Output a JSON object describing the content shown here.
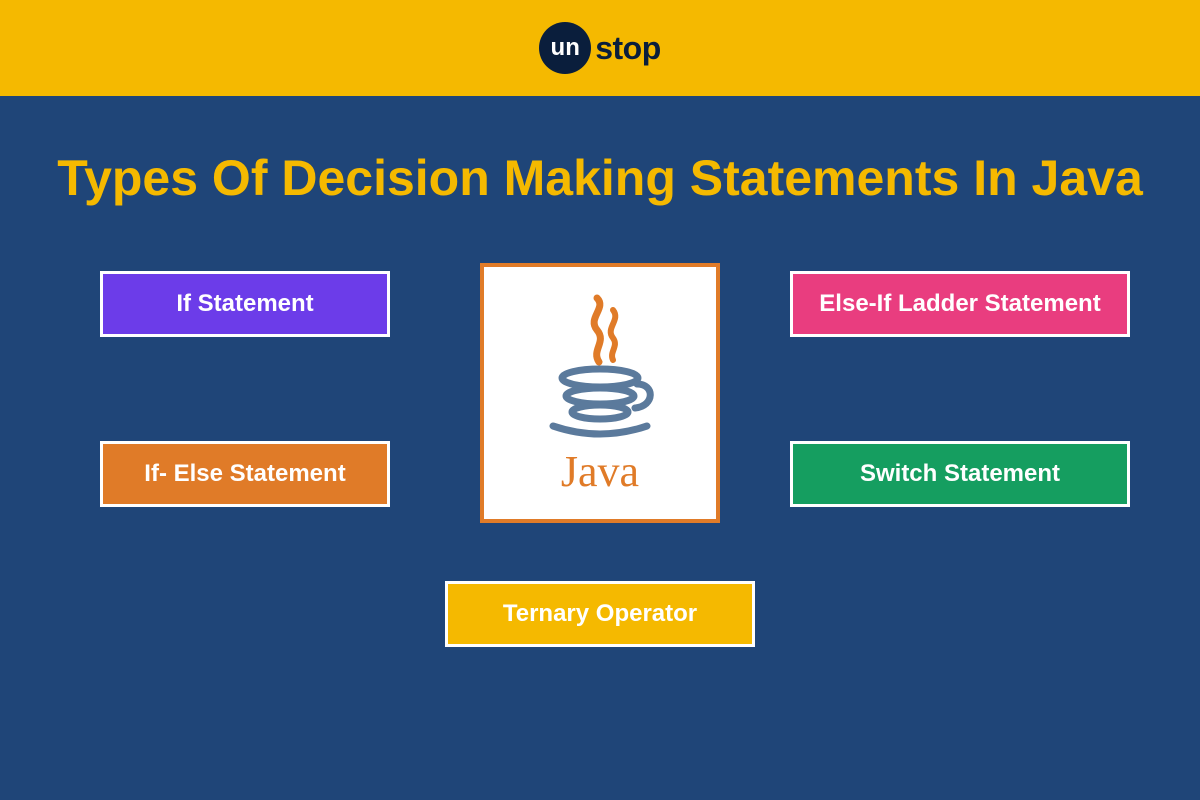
{
  "logo": {
    "circle_text": "un",
    "suffix_text": "stop"
  },
  "title": "Types Of Decision Making Statements In Java",
  "boxes": {
    "if_statement": "If  Statement",
    "if_else_statement": "If- Else Statement",
    "else_if_ladder": "Else-If Ladder Statement",
    "switch_statement": "Switch Statement",
    "ternary_operator": "Ternary Operator"
  },
  "center": {
    "label": "Java"
  },
  "colors": {
    "header": "#f5b900",
    "background": "#1f4578",
    "purple": "#6c3ce9",
    "orange": "#e07b28",
    "pink": "#e93d7f",
    "green": "#159e60",
    "yellow": "#f5b900"
  }
}
